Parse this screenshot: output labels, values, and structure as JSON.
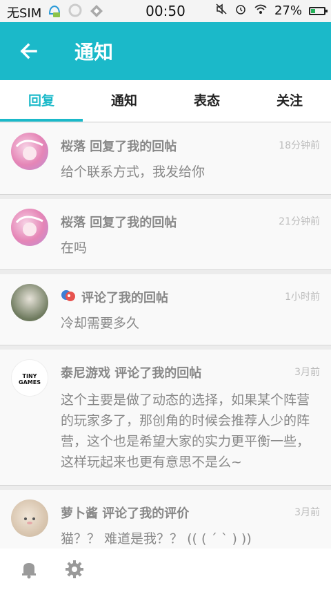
{
  "status": {
    "carrier": "无SIM",
    "time": "00:50",
    "battery": "27%"
  },
  "header": {
    "title": "通知"
  },
  "tabs": [
    {
      "label": "回复"
    },
    {
      "label": "通知"
    },
    {
      "label": "表态"
    },
    {
      "label": "关注"
    }
  ],
  "items": [
    {
      "who": "桜落 回复了我的回帖",
      "when": "18分钟前",
      "msg": "给个联系方式，我发给你"
    },
    {
      "who": "桜落 回复了我的回帖",
      "when": "21分钟前",
      "msg": "在吗"
    },
    {
      "who": "评论了我的回帖",
      "when": "1小时前",
      "msg": "冷却需要多久"
    },
    {
      "who": "泰尼游戏 评论了我的回帖",
      "when": "3月前",
      "msg": "这个主要是做了动态的选择，如果某个阵营的玩家多了，那创角的时候会推荐人少的阵营，这个也是希望大家的实力更平衡一些，这样玩起来也更有意思不是么~",
      "avatar_text": "TINY GAMES"
    },
    {
      "who": "萝卜酱 评论了我的评价",
      "when": "3月前",
      "msg": "猫？？ 难道是我？？ (( ( ˊ ˋ ) ))"
    }
  ],
  "colors": {
    "accent": "#1bb9c9"
  }
}
